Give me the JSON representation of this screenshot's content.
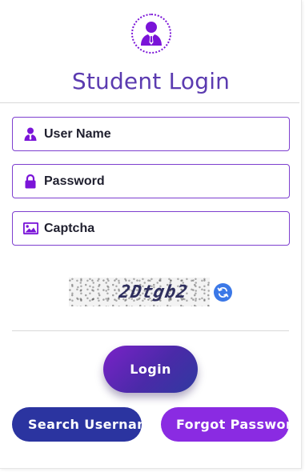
{
  "header": {
    "avatar_icon": "user-tie-icon",
    "title": "Student Login"
  },
  "form": {
    "username": {
      "placeholder": "User Name",
      "value": "",
      "icon": "user-icon"
    },
    "password": {
      "placeholder": "Password",
      "value": "",
      "icon": "lock-icon"
    },
    "captcha": {
      "placeholder": "Captcha",
      "value": "",
      "icon": "image-icon"
    }
  },
  "captcha": {
    "text": "2Dtgb2",
    "refresh_icon": "refresh-icon"
  },
  "buttons": {
    "login": "Login",
    "search_username": "Search Username",
    "forgot_password": "Forgot Password"
  },
  "colors": {
    "accent_purple": "#7a14d8",
    "title": "#5b3bb0",
    "field_border": "#7e3fcf",
    "search_button": "#2b34a0",
    "forgot_button": "#8a2be2",
    "refresh": "#3b78e7"
  }
}
